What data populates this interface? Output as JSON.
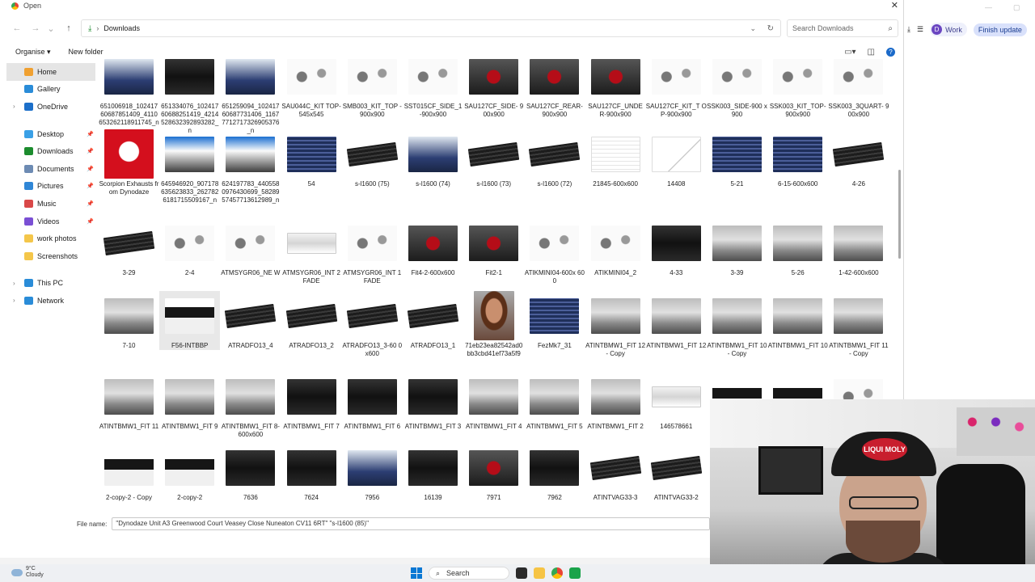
{
  "dialog": {
    "title": "Open",
    "close": "✕",
    "address": {
      "location": "Downloads"
    },
    "search_placeholder": "Search Downloads",
    "commands": {
      "organise": "Organise ▾",
      "new_folder": "New folder"
    },
    "sidebar": [
      {
        "label": "Home",
        "icon": "home-icon",
        "color": "#f0a030",
        "selected": true,
        "pinned": false,
        "expandable": false
      },
      {
        "label": "Gallery",
        "icon": "gallery-icon",
        "color": "#2a8cd8",
        "pinned": false,
        "expandable": false
      },
      {
        "label": "OneDrive",
        "icon": "cloud-icon",
        "color": "#1c6fc9",
        "pinned": false,
        "expandable": true
      },
      {
        "gap": true
      },
      {
        "label": "Desktop",
        "icon": "desktop-icon",
        "color": "#3aa0e6",
        "pinned": true
      },
      {
        "label": "Downloads",
        "icon": "download-icon",
        "color": "#1c8c2e",
        "pinned": true
      },
      {
        "label": "Documents",
        "icon": "documents-icon",
        "color": "#6d8bb3",
        "pinned": true
      },
      {
        "label": "Pictures",
        "icon": "pictures-icon",
        "color": "#2f86d6",
        "pinned": true
      },
      {
        "label": "Music",
        "icon": "music-icon",
        "color": "#d94848",
        "pinned": true
      },
      {
        "label": "Videos",
        "icon": "videos-icon",
        "color": "#7a4fd4",
        "pinned": true
      },
      {
        "label": "work photos",
        "icon": "folder-icon",
        "color": "#f4c64a",
        "pinned": false
      },
      {
        "label": "Screenshots",
        "icon": "folder-icon",
        "color": "#f4c64a",
        "pinned": false
      },
      {
        "gap": true
      },
      {
        "label": "This PC",
        "icon": "pc-icon",
        "color": "#2a8cd8",
        "pinned": false,
        "expandable": true
      },
      {
        "label": "Network",
        "icon": "network-icon",
        "color": "#2a8cd8",
        "pinned": false,
        "expandable": true
      }
    ],
    "files": [
      [
        {
          "name": "651006918_1024176068785140​9_41106532621189117​45_n",
          "thumb": "carblue"
        },
        {
          "name": "651334076_1024176068825141​9_4214528632392893​282_n",
          "thumb": "dark"
        },
        {
          "name": "651259094_1024176068773140​6_1167771271732690​5376_n",
          "thumb": "carblue"
        },
        {
          "name": "SAU044C_KIT TOP-545x545",
          "thumb": "parts"
        },
        {
          "name": "SMB003_KIT_TOP -900x900",
          "thumb": "parts"
        },
        {
          "name": "SST015CF_SIDE_1 -900x900",
          "thumb": "parts"
        },
        {
          "name": "SAU127CF_SIDE- 900x900",
          "thumb": "engine"
        },
        {
          "name": "SAU127CF_REAR- 900x900",
          "thumb": "engine"
        },
        {
          "name": "SAU127CF_UNDE R-900x900",
          "thumb": "engine"
        },
        {
          "name": "SAU127CF_KIT_T OP-900x900",
          "thumb": "parts"
        },
        {
          "name": "SSK003_SIDE-900 x900",
          "thumb": "parts"
        },
        {
          "name": "SSK003_KIT_TOP- 900x900",
          "thumb": "parts"
        },
        {
          "name": "SSK003_3QUART- 900x900",
          "thumb": "parts"
        }
      ],
      [
        {
          "name": "Scorpion Exhausts from Dynodaze",
          "thumb": "scorpion"
        },
        {
          "name": "645946920_9071786356238​33_2627826181715509167_n",
          "thumb": "screen"
        },
        {
          "name": "624197783_4405580976430​699_5828957457713612​989_n",
          "thumb": "screen"
        },
        {
          "name": "54",
          "thumb": "intercooler blue"
        },
        {
          "name": "s-l1600 (75)",
          "thumb": "intercooler"
        },
        {
          "name": "s-l1600 (74)",
          "thumb": "carblue"
        },
        {
          "name": "s-l1600 (73)",
          "thumb": "intercooler"
        },
        {
          "name": "s-l1600 (72)",
          "thumb": "intercooler"
        },
        {
          "name": "21845-600x600",
          "thumb": "doc"
        },
        {
          "name": "14408",
          "thumb": "graph"
        },
        {
          "name": "5-21",
          "thumb": "intercooler blue"
        },
        {
          "name": "6-15-600x600",
          "thumb": "intercooler blue"
        },
        {
          "name": "4-26",
          "thumb": "intercooler"
        }
      ],
      [
        {
          "name": "3-29",
          "thumb": "intercooler"
        },
        {
          "name": "2-4",
          "thumb": "parts"
        },
        {
          "name": "ATMSYGR06_NE W",
          "thumb": "parts"
        },
        {
          "name": "ATMSYGR06_INT 2FADE",
          "thumb": "bumper"
        },
        {
          "name": "ATMSYGR06_INT 1FADE",
          "thumb": "parts"
        },
        {
          "name": "Fit4-2-600x600",
          "thumb": "engine"
        },
        {
          "name": "Fit2-1",
          "thumb": "engine"
        },
        {
          "name": "ATIKMINI04-600x 600",
          "thumb": "parts"
        },
        {
          "name": "ATIKMINI04_2",
          "thumb": "parts"
        },
        {
          "name": "4-33",
          "thumb": "dark"
        },
        {
          "name": "3-39",
          "thumb": "car"
        },
        {
          "name": "5-26",
          "thumb": "car"
        },
        {
          "name": "1-42-600x600",
          "thumb": "car"
        }
      ],
      [
        {
          "name": "7-10",
          "thumb": "car"
        },
        {
          "name": "F56-INTBBP",
          "thumb": "airtec",
          "selected": true
        },
        {
          "name": "ATRADFO13_4",
          "thumb": "intercooler"
        },
        {
          "name": "ATRADFO13_2",
          "thumb": "intercooler"
        },
        {
          "name": "ATRADFO13_3-60 0x600",
          "thumb": "intercooler"
        },
        {
          "name": "ATRADFO13_1",
          "thumb": "intercooler"
        },
        {
          "name": "71eb23ea82542ad0bb3cbd41ef73a5f9",
          "thumb": "person"
        },
        {
          "name": "FezMk7_31",
          "thumb": "intercooler blue"
        },
        {
          "name": "ATINTBMW1_FIT 12 - Copy",
          "thumb": "car"
        },
        {
          "name": "ATINTBMW1_FIT 12",
          "thumb": "car"
        },
        {
          "name": "ATINTBMW1_FIT 10 - Copy",
          "thumb": "car"
        },
        {
          "name": "ATINTBMW1_FIT 10",
          "thumb": "car"
        },
        {
          "name": "ATINTBMW1_FIT 11 - Copy",
          "thumb": "car"
        }
      ],
      [
        {
          "name": "ATINTBMW1_FIT 11",
          "thumb": "car"
        },
        {
          "name": "ATINTBMW1_FIT 9",
          "thumb": "car"
        },
        {
          "name": "ATINTBMW1_FIT 8-600x600",
          "thumb": "car"
        },
        {
          "name": "ATINTBMW1_FIT 7",
          "thumb": "dark"
        },
        {
          "name": "ATINTBMW1_FIT 6",
          "thumb": "dark"
        },
        {
          "name": "ATINTBMW1_FIT 3",
          "thumb": "dark"
        },
        {
          "name": "ATINTBMW1_FIT 4",
          "thumb": "car"
        },
        {
          "name": "ATINTBMW1_FIT 5",
          "thumb": "car"
        },
        {
          "name": "ATINTBMW1_FIT 2",
          "thumb": "car"
        },
        {
          "name": "146578661",
          "thumb": "bumper"
        },
        {
          "name": "",
          "thumb": "airtec"
        },
        {
          "name": "",
          "thumb": "airtec"
        },
        {
          "name": "",
          "thumb": "parts"
        }
      ],
      [
        {
          "name": "2-copy-2 - Copy",
          "thumb": "airtec"
        },
        {
          "name": "2-copy-2",
          "thumb": "airtec"
        },
        {
          "name": "7636",
          "thumb": "dark"
        },
        {
          "name": "7624",
          "thumb": "dark"
        },
        {
          "name": "7956",
          "thumb": "carblue"
        },
        {
          "name": "16139",
          "thumb": "dark"
        },
        {
          "name": "7971",
          "thumb": "engine"
        },
        {
          "name": "7962",
          "thumb": "dark"
        },
        {
          "name": "ATINTVAG33-3",
          "thumb": "intercooler"
        },
        {
          "name": "ATINTVAG33-2",
          "thumb": "intercooler"
        }
      ]
    ],
    "filename_label": "File name:",
    "filename_value": "\"Dynodaze Unit A3 Greenwood Court Veasey Close Nuneaton CV11 6RT\" \"s-l1600 (85)\""
  },
  "browser": {
    "profile_initial": "D",
    "profile_label": "Work",
    "finish_update": "Finish update"
  },
  "webcam": {
    "cap_text": "LIQUI MOLY"
  },
  "taskbar": {
    "temperature": "9°C",
    "condition": "Cloudy",
    "search": "Search"
  }
}
